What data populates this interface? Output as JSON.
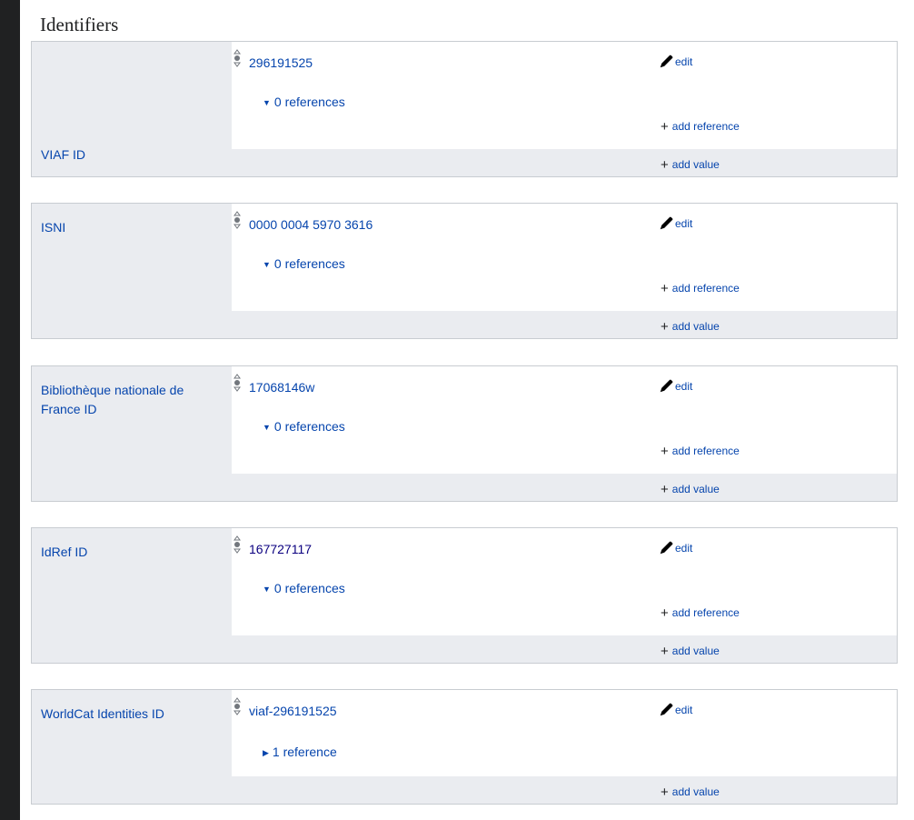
{
  "section": {
    "title": "Identifiers"
  },
  "ui": {
    "edit": "edit",
    "add_reference": "add reference",
    "add_value": "add value"
  },
  "groups": [
    {
      "label": "VIAF ID",
      "value": "296191525",
      "references": "0 references",
      "refs_expanded": true
    },
    {
      "label": "ISNI",
      "value": "0000 0004 5970 3616",
      "references": "0 references",
      "refs_expanded": true
    },
    {
      "label": "Bibliothèque nationale de France ID",
      "value": "17068146w",
      "references": "0 references",
      "refs_expanded": true
    },
    {
      "label": "IdRef ID",
      "value": "167727117",
      "references": "0 references",
      "refs_expanded": true
    },
    {
      "label": "WorldCat Identities ID",
      "value": "viaf-296191525",
      "references": "1 reference",
      "refs_expanded": false
    }
  ]
}
